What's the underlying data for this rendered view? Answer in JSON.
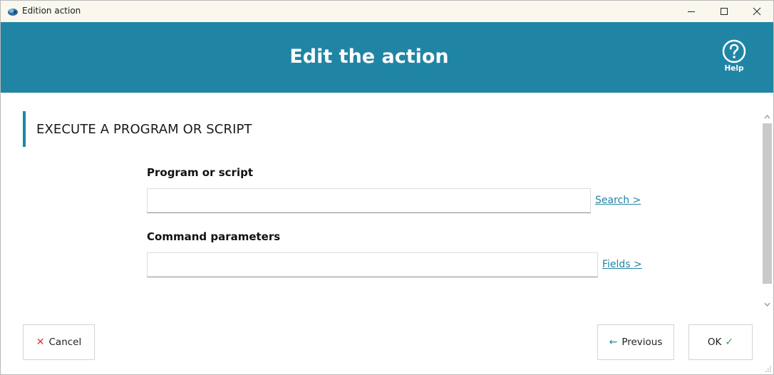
{
  "window": {
    "title": "Edition action",
    "controls": {
      "minimize": "minimize",
      "maximize": "maximize",
      "close": "close"
    }
  },
  "header": {
    "title": "Edit the action",
    "help_label": "Help",
    "color": "#2085a5"
  },
  "section": {
    "title": "EXECUTE A PROGRAM OR SCRIPT"
  },
  "form": {
    "program": {
      "label": "Program or script",
      "value": "",
      "link": "Search >"
    },
    "params": {
      "label": "Command parameters",
      "value": "",
      "link": "Fields >"
    }
  },
  "footer": {
    "cancel": "Cancel",
    "previous": "Previous",
    "ok": "OK"
  },
  "icons": {
    "cancel": "x-icon",
    "previous": "arrow-left-icon",
    "ok": "check-icon",
    "help": "help-circle-icon"
  }
}
